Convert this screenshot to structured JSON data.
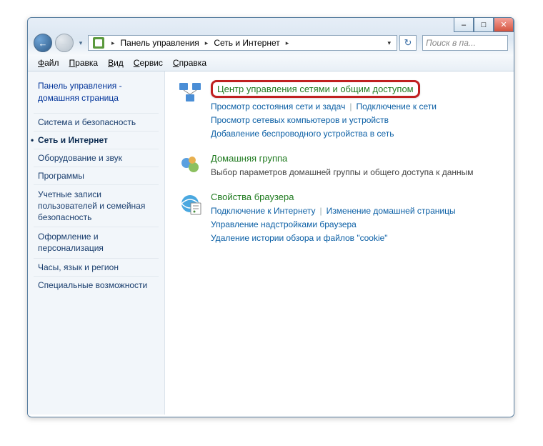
{
  "window_controls": {
    "min": "–",
    "max": "□",
    "close": "✕"
  },
  "breadcrumb": {
    "root_sep": "▸",
    "item1": "Панель управления",
    "sep": "▸",
    "item2": "Сеть и Интернет",
    "tail": "▸"
  },
  "toolbar": {
    "back": "←",
    "forward": "→",
    "drop": "▾",
    "refresh": "↻",
    "search_placeholder": "Поиск в па..."
  },
  "menu": {
    "file": "айл",
    "file_u": "Ф",
    "edit": "равка",
    "edit_u": "П",
    "view": "ид",
    "view_u": "В",
    "tools": "ервис",
    "tools_u": "С",
    "help": "правка",
    "help_u": "С"
  },
  "sidebar": {
    "home": "Панель управления -\nдомашняя страница",
    "items": [
      "Система и безопасность",
      "Сеть и Интернет",
      "Оборудование и звук",
      "Программы",
      "Учетные записи\nпользователей и семейная\nбезопасность",
      "Оформление и\nперсонализация",
      "Часы, язык и регион",
      "Специальные возможности"
    ],
    "active_index": 1
  },
  "sections": [
    {
      "icon": "network",
      "title": "Центр управления сетями и общим доступом",
      "highlight": true,
      "sublinks": [
        [
          "Просмотр состояния сети и задач",
          "Подключение к сети"
        ],
        [
          "Просмотр сетевых компьютеров и устройств"
        ],
        [
          "Добавление беспроводного устройства в сеть"
        ]
      ]
    },
    {
      "icon": "homegroup",
      "title": "Домашняя группа",
      "subtext": "Выбор параметров домашней группы и общего доступа к данным"
    },
    {
      "icon": "browser",
      "title": "Свойства браузера",
      "sublinks": [
        [
          "Подключение к Интернету",
          "Изменение домашней страницы"
        ],
        [
          "Управление надстройками браузера"
        ],
        [
          "Удаление истории обзора и файлов \"cookie\""
        ]
      ]
    }
  ]
}
